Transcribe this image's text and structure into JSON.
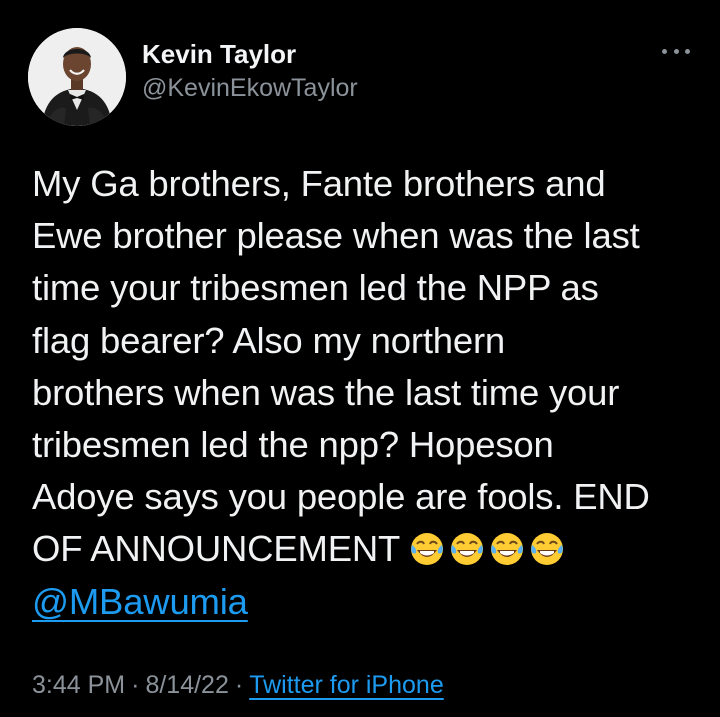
{
  "author": {
    "display_name": "Kevin Taylor",
    "handle": "@KevinEkowTaylor"
  },
  "tweet": {
    "lines": [
      "My Ga brothers, Fante brothers and",
      "Ewe brother please when was the last",
      "time your tribesmen led the NPP as",
      "flag bearer? Also my northern",
      "brothers when was the last time your",
      "tribesmen led the npp? Hopeson",
      "Adoye says you people are fools. END",
      "OF ANNOUNCEMENT"
    ],
    "emoji": [
      "face-with-tears-of-joy",
      "face-with-tears-of-joy",
      "face-with-tears-of-joy",
      "face-with-tears-of-joy"
    ],
    "mention": "@MBawumia"
  },
  "meta": {
    "time": "3:44 PM",
    "separator": "·",
    "date": "8/14/22",
    "source": "Twitter for iPhone"
  },
  "icons": {
    "more": "more-horizontal-icon",
    "emoji": "face-with-tears-of-joy-icon"
  },
  "colors": {
    "background": "#000000",
    "text": "#e7e9ea",
    "secondary": "#8b9299",
    "link": "#1d9bf0"
  }
}
